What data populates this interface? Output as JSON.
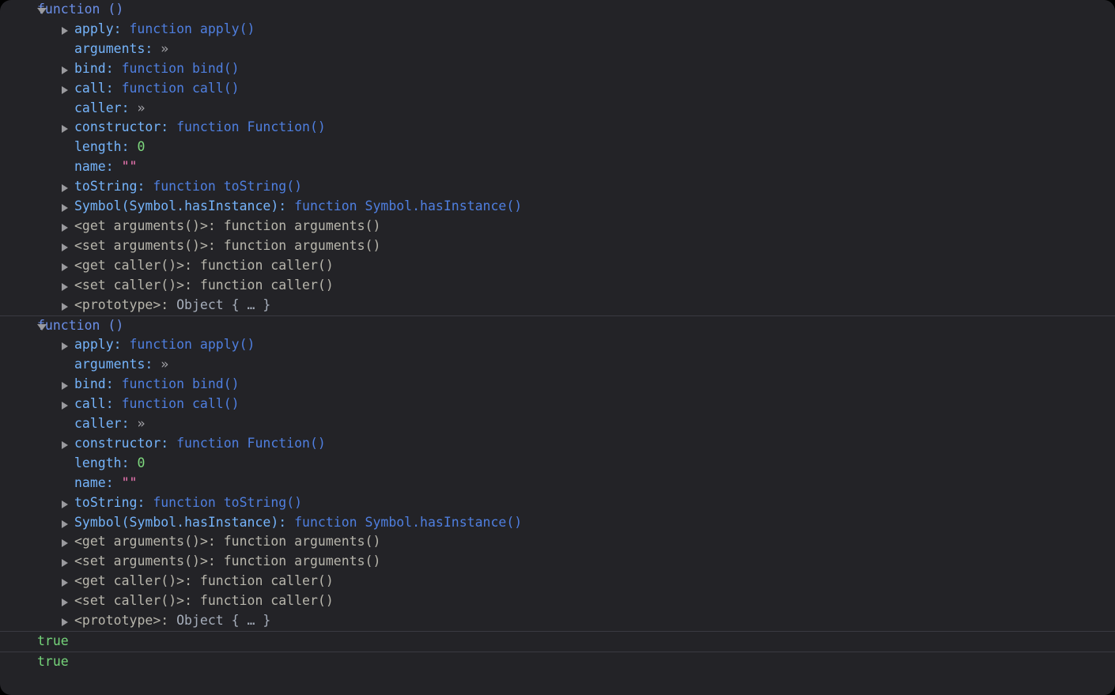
{
  "panel": {
    "background": "#232327",
    "outer_background": "#000000",
    "separator_color": "#3a3a41"
  },
  "colors": {
    "object_header": "#6b8fe8",
    "property_name": "#75b4fb",
    "function_value": "#4f7fe0",
    "number": "#7ed97e",
    "string": "#f178b6",
    "dim_accessor": "#b8b6ac",
    "object_value": "#a6aebb",
    "boolean": "#75d47a",
    "twisty": "#9a9a9e"
  },
  "messages": [
    {
      "id": "message-1",
      "type": "object-inspector",
      "header": {
        "twisty": "expanded",
        "text": "function ()"
      },
      "rows": [
        {
          "twisty": "collapsed",
          "name": "apply",
          "sep": ":",
          "value": "function apply()",
          "value_kind": "function"
        },
        {
          "twisty": "none",
          "name": "arguments",
          "sep": ":",
          "value": "»",
          "value_kind": "chevron"
        },
        {
          "twisty": "collapsed",
          "name": "bind",
          "sep": ":",
          "value": "function bind()",
          "value_kind": "function"
        },
        {
          "twisty": "collapsed",
          "name": "call",
          "sep": ":",
          "value": "function call()",
          "value_kind": "function"
        },
        {
          "twisty": "none",
          "name": "caller",
          "sep": ":",
          "value": "»",
          "value_kind": "chevron"
        },
        {
          "twisty": "collapsed",
          "name": "constructor",
          "sep": ":",
          "value": "function Function()",
          "value_kind": "function"
        },
        {
          "twisty": "none",
          "name": "length",
          "sep": ":",
          "value": "0",
          "value_kind": "number"
        },
        {
          "twisty": "none",
          "name": "name",
          "sep": ":",
          "value": "\"\"",
          "value_kind": "string"
        },
        {
          "twisty": "collapsed",
          "name": "toString",
          "sep": ":",
          "value": "function toString()",
          "value_kind": "function"
        },
        {
          "twisty": "collapsed",
          "name": "Symbol(Symbol.hasInstance)",
          "sep": ":",
          "value": "function Symbol.hasInstance()",
          "value_kind": "function"
        },
        {
          "twisty": "collapsed",
          "name": "<get arguments()>",
          "sep": ":",
          "value": "function arguments()",
          "value_kind": "dim"
        },
        {
          "twisty": "collapsed",
          "name": "<set arguments()>",
          "sep": ":",
          "value": "function arguments()",
          "value_kind": "dim"
        },
        {
          "twisty": "collapsed",
          "name": "<get caller()>",
          "sep": ":",
          "value": "function caller()",
          "value_kind": "dim"
        },
        {
          "twisty": "collapsed",
          "name": "<set caller()>",
          "sep": ":",
          "value": "function caller()",
          "value_kind": "dim"
        },
        {
          "twisty": "collapsed",
          "name": "<prototype>",
          "sep": ":",
          "value": "Object { … }",
          "value_kind": "object"
        }
      ]
    },
    {
      "id": "message-2",
      "type": "object-inspector",
      "header": {
        "twisty": "expanded",
        "text": "function ()"
      },
      "rows": [
        {
          "twisty": "collapsed",
          "name": "apply",
          "sep": ":",
          "value": "function apply()",
          "value_kind": "function"
        },
        {
          "twisty": "none",
          "name": "arguments",
          "sep": ":",
          "value": "»",
          "value_kind": "chevron"
        },
        {
          "twisty": "collapsed",
          "name": "bind",
          "sep": ":",
          "value": "function bind()",
          "value_kind": "function"
        },
        {
          "twisty": "collapsed",
          "name": "call",
          "sep": ":",
          "value": "function call()",
          "value_kind": "function"
        },
        {
          "twisty": "none",
          "name": "caller",
          "sep": ":",
          "value": "»",
          "value_kind": "chevron"
        },
        {
          "twisty": "collapsed",
          "name": "constructor",
          "sep": ":",
          "value": "function Function()",
          "value_kind": "function"
        },
        {
          "twisty": "none",
          "name": "length",
          "sep": ":",
          "value": "0",
          "value_kind": "number"
        },
        {
          "twisty": "none",
          "name": "name",
          "sep": ":",
          "value": "\"\"",
          "value_kind": "string"
        },
        {
          "twisty": "collapsed",
          "name": "toString",
          "sep": ":",
          "value": "function toString()",
          "value_kind": "function"
        },
        {
          "twisty": "collapsed",
          "name": "Symbol(Symbol.hasInstance)",
          "sep": ":",
          "value": "function Symbol.hasInstance()",
          "value_kind": "function"
        },
        {
          "twisty": "collapsed",
          "name": "<get arguments()>",
          "sep": ":",
          "value": "function arguments()",
          "value_kind": "dim"
        },
        {
          "twisty": "collapsed",
          "name": "<set arguments()>",
          "sep": ":",
          "value": "function arguments()",
          "value_kind": "dim"
        },
        {
          "twisty": "collapsed",
          "name": "<get caller()>",
          "sep": ":",
          "value": "function caller()",
          "value_kind": "dim"
        },
        {
          "twisty": "collapsed",
          "name": "<set caller()>",
          "sep": ":",
          "value": "function caller()",
          "value_kind": "dim"
        },
        {
          "twisty": "collapsed",
          "name": "<prototype>",
          "sep": ":",
          "value": "Object { … }",
          "value_kind": "object"
        }
      ]
    },
    {
      "id": "message-3",
      "type": "boolean-result",
      "value": "true"
    },
    {
      "id": "message-4",
      "type": "boolean-result",
      "value": "true"
    }
  ]
}
